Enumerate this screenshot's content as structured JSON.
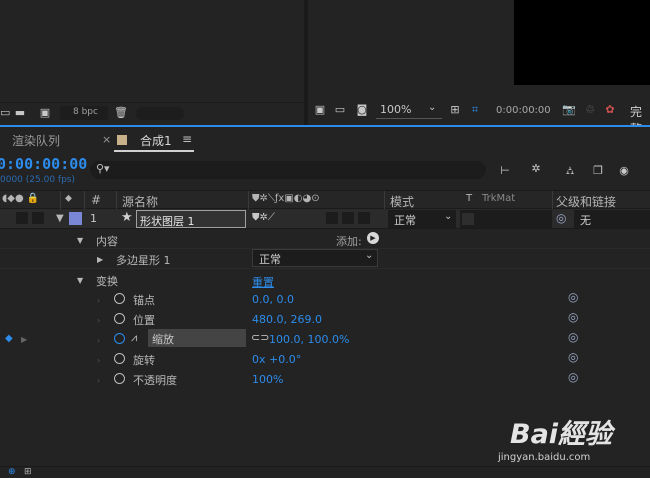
{
  "project_panel": {
    "bpc_label": "8 bpc"
  },
  "viewer": {
    "zoom": "100%",
    "timecode": "0:00:00:00",
    "quality": "完整"
  },
  "tabs": [
    {
      "label": "渲染队列"
    },
    {
      "label": "合成1"
    }
  ],
  "tab_comp": {
    "close_glyph": "×",
    "menu_glyph": "≡"
  },
  "timeline": {
    "current_time": "0:00:00:00",
    "fps_text": "0000 (25.00 fps)",
    "search_placeholder": ""
  },
  "headers": {
    "number": "#",
    "source_name": "源名称",
    "mode": "模式",
    "t": "T",
    "trkmat": "TrkMat",
    "parent": "父级和链接"
  },
  "layer": {
    "number": "1",
    "name": "形状图层 1",
    "mode": "正常",
    "parent": "无"
  },
  "properties": {
    "contents": "内容",
    "add_label": "添加:",
    "polystar": "多边星形 1",
    "blend_mode": "正常",
    "transform": "变换",
    "reset": "重置",
    "anchor": {
      "label": "锚点",
      "value": "0.0, 0.0"
    },
    "position": {
      "label": "位置",
      "value": "480.0, 269.0"
    },
    "scale": {
      "label": "缩放",
      "value": "100.0, 100.0%"
    },
    "rotation": {
      "label": "旋转",
      "value": "0x +0.0°"
    },
    "opacity": {
      "label": "不透明度",
      "value": "100%"
    }
  },
  "watermark": {
    "brand": "Bai經验",
    "url": "jingyan.baidu.com"
  },
  "colors": {
    "accent": "#2d8ceb",
    "label_color": "#7a86d6"
  }
}
